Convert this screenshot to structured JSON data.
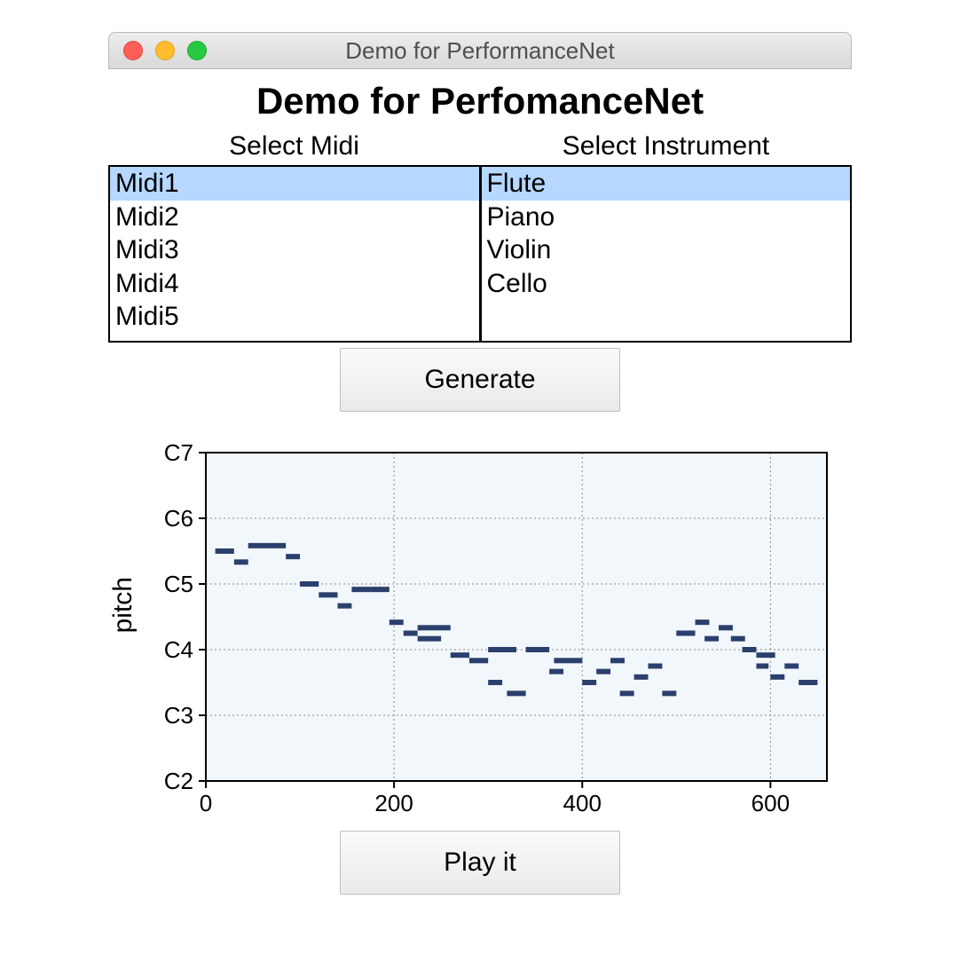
{
  "window": {
    "title": "Demo for PerformanceNet"
  },
  "page_title": "Demo for PerfomanceNet",
  "columns": {
    "left": "Select Midi",
    "right": "Select Instrument"
  },
  "midi": {
    "items": [
      "Midi1",
      "Midi2",
      "Midi3",
      "Midi4",
      "Midi5"
    ],
    "selected_index": 0
  },
  "inst": {
    "items": [
      "Flute",
      "Piano",
      "Violin",
      "Cello"
    ],
    "selected_index": 0
  },
  "buttons": {
    "generate": "Generate",
    "play": "Play it"
  },
  "colors": {
    "selection": "#b6d7ff",
    "note": "#2a3f6b",
    "plot_bg": "#f2f7fc"
  },
  "chart_data": {
    "type": "scatter",
    "title": "",
    "xlabel": "",
    "ylabel": "pitch",
    "xlim": [
      0,
      660
    ],
    "ylim": [
      36,
      96
    ],
    "xticks": [
      0,
      200,
      400,
      600
    ],
    "yticks": [
      {
        "value": 36,
        "label": "C2"
      },
      {
        "value": 48,
        "label": "C3"
      },
      {
        "value": 60,
        "label": "C4"
      },
      {
        "value": 72,
        "label": "C5"
      },
      {
        "value": 84,
        "label": "C6"
      },
      {
        "value": 96,
        "label": "C7"
      }
    ],
    "notes": [
      {
        "start": 10,
        "end": 30,
        "pitch": 78
      },
      {
        "start": 30,
        "end": 45,
        "pitch": 76
      },
      {
        "start": 45,
        "end": 85,
        "pitch": 79
      },
      {
        "start": 85,
        "end": 100,
        "pitch": 77
      },
      {
        "start": 100,
        "end": 120,
        "pitch": 72
      },
      {
        "start": 120,
        "end": 140,
        "pitch": 70
      },
      {
        "start": 140,
        "end": 155,
        "pitch": 68
      },
      {
        "start": 155,
        "end": 175,
        "pitch": 71
      },
      {
        "start": 175,
        "end": 195,
        "pitch": 71
      },
      {
        "start": 195,
        "end": 210,
        "pitch": 65
      },
      {
        "start": 210,
        "end": 225,
        "pitch": 63
      },
      {
        "start": 225,
        "end": 250,
        "pitch": 62
      },
      {
        "start": 225,
        "end": 260,
        "pitch": 64
      },
      {
        "start": 260,
        "end": 280,
        "pitch": 59
      },
      {
        "start": 280,
        "end": 300,
        "pitch": 58
      },
      {
        "start": 300,
        "end": 330,
        "pitch": 60
      },
      {
        "start": 300,
        "end": 315,
        "pitch": 54
      },
      {
        "start": 320,
        "end": 340,
        "pitch": 52
      },
      {
        "start": 340,
        "end": 365,
        "pitch": 60
      },
      {
        "start": 365,
        "end": 380,
        "pitch": 56
      },
      {
        "start": 370,
        "end": 400,
        "pitch": 58
      },
      {
        "start": 400,
        "end": 415,
        "pitch": 54
      },
      {
        "start": 415,
        "end": 430,
        "pitch": 56
      },
      {
        "start": 430,
        "end": 445,
        "pitch": 58
      },
      {
        "start": 440,
        "end": 455,
        "pitch": 52
      },
      {
        "start": 455,
        "end": 470,
        "pitch": 55
      },
      {
        "start": 470,
        "end": 485,
        "pitch": 57
      },
      {
        "start": 485,
        "end": 500,
        "pitch": 52
      },
      {
        "start": 500,
        "end": 520,
        "pitch": 63
      },
      {
        "start": 520,
        "end": 535,
        "pitch": 65
      },
      {
        "start": 530,
        "end": 545,
        "pitch": 62
      },
      {
        "start": 545,
        "end": 560,
        "pitch": 64
      },
      {
        "start": 558,
        "end": 573,
        "pitch": 62
      },
      {
        "start": 570,
        "end": 585,
        "pitch": 60
      },
      {
        "start": 585,
        "end": 605,
        "pitch": 59
      },
      {
        "start": 585,
        "end": 598,
        "pitch": 57
      },
      {
        "start": 600,
        "end": 615,
        "pitch": 55
      },
      {
        "start": 615,
        "end": 630,
        "pitch": 57
      },
      {
        "start": 630,
        "end": 650,
        "pitch": 54
      }
    ]
  }
}
